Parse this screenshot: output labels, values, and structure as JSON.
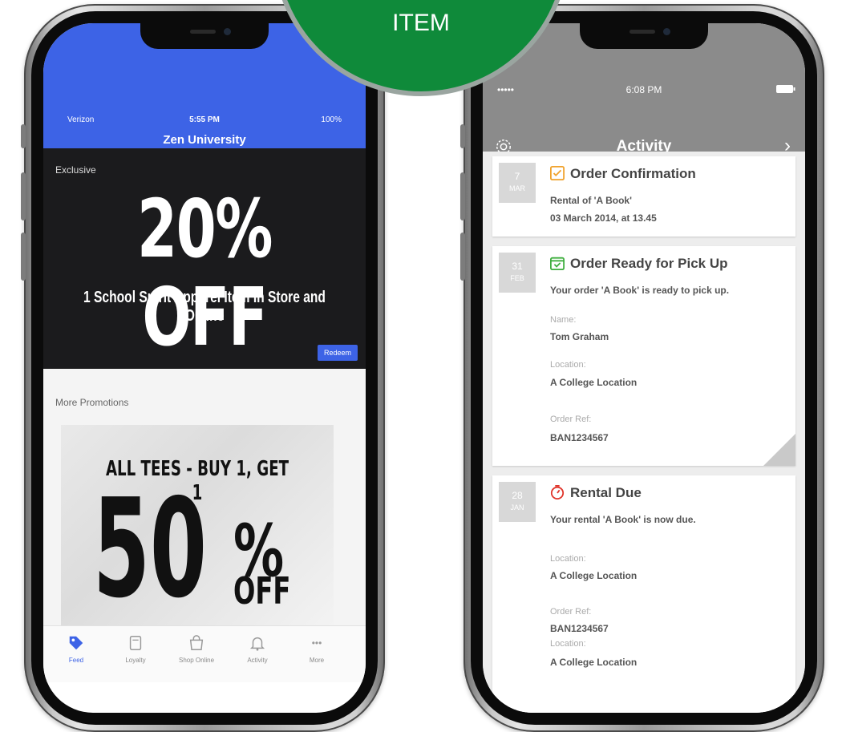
{
  "badge": {
    "text": "ITEM",
    "color": "#0f8a3a"
  },
  "left_phone": {
    "status": {
      "carrier": "Verizon",
      "time": "5:55 PM",
      "battery": "100%"
    },
    "app_title": "Zen University",
    "promo": {
      "eyebrow": "Exclusive",
      "headline": "20% OFF",
      "subline": "1 School Spirit Apparel Item In Store and Online",
      "action": "Redeem"
    },
    "more": {
      "label": "More Promotions",
      "banner_line1": "ALL TEES - BUY 1, GET 1",
      "banner_big": "50",
      "banner_pct": "%",
      "banner_off": "OFF"
    },
    "tabs": [
      {
        "label": "Feed",
        "icon": "tag-icon"
      },
      {
        "label": "Loyalty",
        "icon": "card-icon"
      },
      {
        "label": "Shop Online",
        "icon": "bag-icon"
      },
      {
        "label": "Activity",
        "icon": "bell-icon"
      },
      {
        "label": "More",
        "icon": "dots-icon",
        "glyph": "•••"
      }
    ]
  },
  "right_phone": {
    "status": {
      "carrier": "•••••",
      "time": "6:08 PM"
    },
    "title": "Activity",
    "cards": [
      {
        "day": "7",
        "month": "MAR",
        "title": "Order Confirmation",
        "icon": "checkbox-icon",
        "icon_color": "#f0a22c",
        "lines": [
          "Rental of 'A Book'",
          "03 March 2014, at 13.45"
        ]
      },
      {
        "day": "31",
        "month": "FEB",
        "title": "Order Ready for Pick Up",
        "icon": "calendar-check-icon",
        "icon_color": "#3fae3f",
        "message": "Your order 'A Book' is ready to pick up.",
        "name_label": "Name:",
        "name": "Tom Graham",
        "loc_label": "Location:",
        "location": "A College Location",
        "ref_label": "Order Ref:",
        "ref": "BAN1234567"
      },
      {
        "day": "28",
        "month": "JAN",
        "title": "Rental Due",
        "icon": "stopwatch-icon",
        "icon_color": "#e0352b",
        "message": "Your rental 'A Book' is now due.",
        "loc_label": "Location:",
        "location": "A College Location",
        "ref_label": "Order Ref:",
        "ref": "BAN1234567",
        "loc2_label": "Location:",
        "location2": "A College Location"
      }
    ]
  }
}
